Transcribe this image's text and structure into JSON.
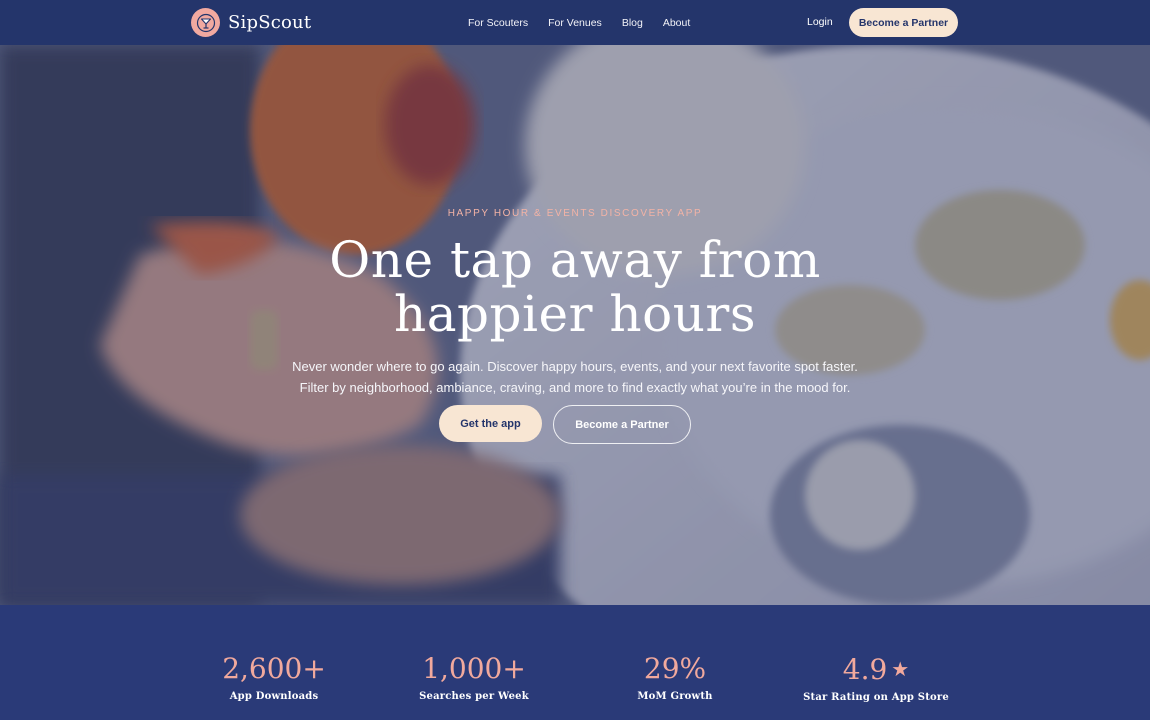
{
  "nav": {
    "brand": "SipScout",
    "links": [
      "For Scouters",
      "For Venues",
      "Blog",
      "About"
    ],
    "login": "Login",
    "partner_cta": "Become a Partner"
  },
  "hero": {
    "eyebrow": "HAPPY HOUR & EVENTS DISCOVERY APP",
    "headline_line1": "One tap away from",
    "headline_line2": "happier hours",
    "subtext_line1": "Never wonder where to go again. Discover happy hours, events, and your next favorite spot faster.",
    "subtext_line2": "Filter by neighborhood, ambiance, craving, and more to find exactly what you’re in the mood for.",
    "cta_primary": "Get the app",
    "cta_secondary": "Become a Partner"
  },
  "stats": [
    {
      "value": "2,600+",
      "label": "App Downloads"
    },
    {
      "value": "1,000+",
      "label": "Searches per Week"
    },
    {
      "value": "29%",
      "label": "MoM Growth"
    },
    {
      "value": "4.9",
      "star": "★",
      "label": "Star Rating on App Store"
    }
  ],
  "colors": {
    "navy": "#24356b",
    "cream": "#f8e6d3",
    "coral": "#f1a99d"
  }
}
